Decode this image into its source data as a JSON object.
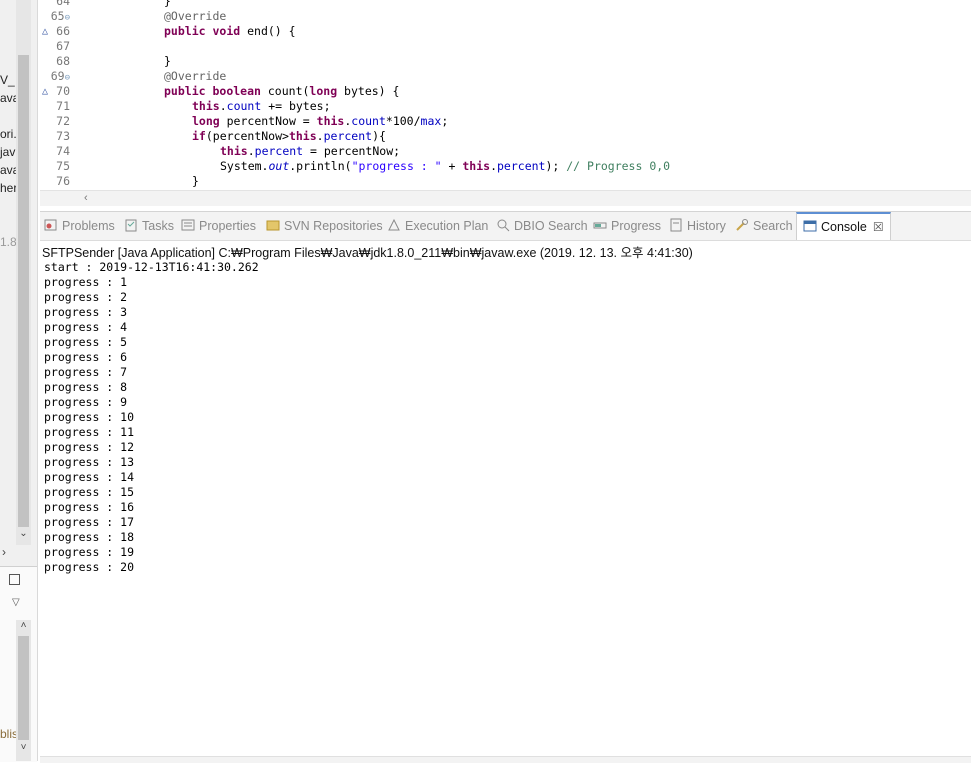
{
  "left_panel": {
    "clipped_labels": [
      "V_",
      "ava",
      "ori.",
      "jav",
      "ava",
      "her",
      "1.8.",
      "blis"
    ]
  },
  "editor": {
    "lines": [
      {
        "num": "64",
        "fold": "",
        "override": false,
        "code": [
          {
            "t": "}",
            "c": ""
          }
        ]
      },
      {
        "num": "65",
        "fold": "⊖",
        "override": false,
        "code": [
          {
            "t": "@Override",
            "c": "ann"
          }
        ]
      },
      {
        "num": "66",
        "fold": "",
        "override": true,
        "code": [
          {
            "t": "public",
            "c": "kw"
          },
          {
            "t": " ",
            "c": ""
          },
          {
            "t": "void",
            "c": "kw"
          },
          {
            "t": " end() {",
            "c": ""
          }
        ]
      },
      {
        "num": "67",
        "fold": "",
        "override": false,
        "code": []
      },
      {
        "num": "68",
        "fold": "",
        "override": false,
        "code": [
          {
            "t": "}",
            "c": ""
          }
        ]
      },
      {
        "num": "69",
        "fold": "⊖",
        "override": false,
        "code": [
          {
            "t": "@Override",
            "c": "ann"
          }
        ]
      },
      {
        "num": "70",
        "fold": "",
        "override": true,
        "code": [
          {
            "t": "public",
            "c": "kw"
          },
          {
            "t": " ",
            "c": ""
          },
          {
            "t": "boolean",
            "c": "kw"
          },
          {
            "t": " count(",
            "c": ""
          },
          {
            "t": "long",
            "c": "kw"
          },
          {
            "t": " bytes) {",
            "c": ""
          }
        ]
      },
      {
        "num": "71",
        "fold": "",
        "override": false,
        "indent": 1,
        "code": [
          {
            "t": "this",
            "c": "kw"
          },
          {
            "t": ".",
            "c": ""
          },
          {
            "t": "count",
            "c": "fld"
          },
          {
            "t": " += bytes;",
            "c": ""
          }
        ]
      },
      {
        "num": "72",
        "fold": "",
        "override": false,
        "indent": 1,
        "code": [
          {
            "t": "long",
            "c": "kw"
          },
          {
            "t": " percentNow = ",
            "c": ""
          },
          {
            "t": "this",
            "c": "kw"
          },
          {
            "t": ".",
            "c": ""
          },
          {
            "t": "count",
            "c": "fld"
          },
          {
            "t": "*100/",
            "c": ""
          },
          {
            "t": "max",
            "c": "fld"
          },
          {
            "t": ";",
            "c": ""
          }
        ]
      },
      {
        "num": "73",
        "fold": "",
        "override": false,
        "indent": 1,
        "code": [
          {
            "t": "if",
            "c": "kw"
          },
          {
            "t": "(percentNow>",
            "c": ""
          },
          {
            "t": "this",
            "c": "kw"
          },
          {
            "t": ".",
            "c": ""
          },
          {
            "t": "percent",
            "c": "fld"
          },
          {
            "t": "){",
            "c": ""
          }
        ]
      },
      {
        "num": "74",
        "fold": "",
        "override": false,
        "indent": 2,
        "code": [
          {
            "t": "this",
            "c": "kw"
          },
          {
            "t": ".",
            "c": ""
          },
          {
            "t": "percent",
            "c": "fld"
          },
          {
            "t": " = percentNow;",
            "c": ""
          }
        ]
      },
      {
        "num": "75",
        "fold": "",
        "override": false,
        "indent": 2,
        "code": [
          {
            "t": "System.",
            "c": ""
          },
          {
            "t": "out",
            "c": "st"
          },
          {
            "t": ".println(",
            "c": ""
          },
          {
            "t": "\"progress : \"",
            "c": "str"
          },
          {
            "t": " + ",
            "c": ""
          },
          {
            "t": "this",
            "c": "kw"
          },
          {
            "t": ".",
            "c": ""
          },
          {
            "t": "percent",
            "c": "fld"
          },
          {
            "t": "); ",
            "c": ""
          },
          {
            "t": "// Progress 0,0",
            "c": "com"
          }
        ]
      },
      {
        "num": "76",
        "fold": "",
        "override": false,
        "indent": 1,
        "code": [
          {
            "t": "}",
            "c": ""
          }
        ]
      }
    ]
  },
  "tabs": [
    {
      "label": "Problems",
      "icon": "problems-icon",
      "active": false
    },
    {
      "label": "Tasks",
      "icon": "tasks-icon",
      "active": false
    },
    {
      "label": "Properties",
      "icon": "properties-icon",
      "active": false
    },
    {
      "label": "SVN Repositories",
      "icon": "svn-repositories-icon",
      "active": false
    },
    {
      "label": "Execution Plan",
      "icon": "execution-plan-icon",
      "active": false
    },
    {
      "label": "DBIO Search",
      "icon": "dbio-search-icon",
      "active": false
    },
    {
      "label": "Progress",
      "icon": "progress-icon",
      "active": false
    },
    {
      "label": "History",
      "icon": "history-icon",
      "active": false
    },
    {
      "label": "Search",
      "icon": "search-icon",
      "active": false
    },
    {
      "label": "Console",
      "icon": "console-icon",
      "active": true,
      "close": "☒"
    }
  ],
  "console": {
    "description": "SFTPSender [Java Application] C:₩Program Files₩Java₩jdk1.8.0_211₩bin₩javaw.exe (2019. 12. 13. 오후 4:41:30)",
    "output": [
      "start : 2019-12-13T16:41:30.262",
      "progress : 1",
      "progress : 2",
      "progress : 3",
      "progress : 4",
      "progress : 5",
      "progress : 6",
      "progress : 7",
      "progress : 8",
      "progress : 9",
      "progress : 10",
      "progress : 11",
      "progress : 12",
      "progress : 13",
      "progress : 14",
      "progress : 15",
      "progress : 16",
      "progress : 17",
      "progress : 18",
      "progress : 19",
      "progress : 20"
    ]
  },
  "colors": {
    "keyword": "#7f0055",
    "annotation": "#646464",
    "field": "#0000c0",
    "string": "#2a00ff",
    "comment": "#3f7f5f",
    "active_tab_accent": "#5e8fd3"
  }
}
